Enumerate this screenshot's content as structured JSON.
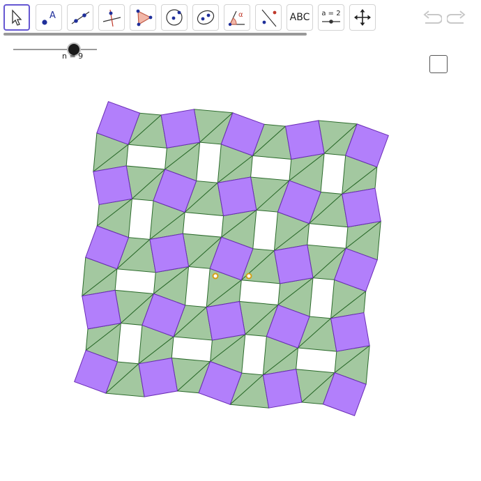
{
  "toolbar": {
    "tools": [
      {
        "name": "move-tool-button",
        "icon": "cursor-arrow-icon",
        "active": true
      },
      {
        "name": "point-tool-button",
        "icon": "point-icon",
        "label": "A"
      },
      {
        "name": "line-tool-button",
        "icon": "line-through-points-icon"
      },
      {
        "name": "perpendicular-tool-button",
        "icon": "perpendicular-line-icon"
      },
      {
        "name": "polygon-tool-button",
        "icon": "polygon-icon"
      },
      {
        "name": "circle-tool-button",
        "icon": "circle-center-point-icon"
      },
      {
        "name": "ellipse-tool-button",
        "icon": "ellipse-icon"
      },
      {
        "name": "angle-tool-button",
        "icon": "angle-icon",
        "label": "α"
      },
      {
        "name": "reflect-tool-button",
        "icon": "reflect-about-line-icon"
      },
      {
        "name": "text-tool-button",
        "icon": "text-icon",
        "label": "ABC"
      },
      {
        "name": "slider-tool-button",
        "icon": "slider-icon",
        "label": "a = 2"
      },
      {
        "name": "move-graphics-view-button",
        "icon": "move-arrows-icon"
      }
    ],
    "undo_icon": "undo-icon",
    "redo_icon": "redo-icon"
  },
  "slider": {
    "label": "n = 9",
    "value": 9
  },
  "checkbox": {
    "checked": false
  },
  "colors": {
    "square_fill": "#b27ffb",
    "square_stroke": "#6a2bb5",
    "triangle_fill": "#a3c8a0",
    "triangle_stroke": "#2b6a2b",
    "accent": "#6557d2",
    "point": "#d4a017"
  }
}
